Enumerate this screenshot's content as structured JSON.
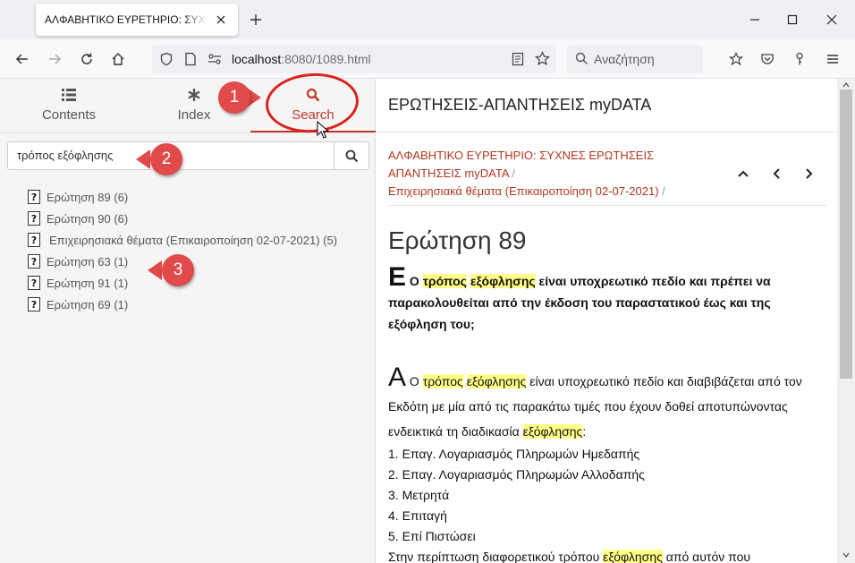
{
  "browser": {
    "tab_title": "ΑΛΦΑΒΗΤΙΚΟ ΕΥΡΕΤΗΡΙΟ: ΣΥΧΝΕΣ ΕΡΩΤΗΣΕΙΣ",
    "url_host": "localhost",
    "url_rest": ":8080/1089.html",
    "search_placeholder": "Αναζήτηση"
  },
  "sidebar": {
    "tabs": [
      {
        "label": "Contents",
        "icon": "list-icon"
      },
      {
        "label": "Index",
        "icon": "asterisk-icon"
      },
      {
        "label": "Search",
        "icon": "search-icon"
      }
    ],
    "active_tab": "Search",
    "search_value": "τρόπος εξόφλησης",
    "results": [
      {
        "label": "Ερώτηση 89 (6)"
      },
      {
        "label": "Ερώτηση 90 (6)"
      },
      {
        "label": "Επιχειρησιακά θέματα (Επικαιροποίηση 02-07-2021) (5)"
      },
      {
        "label": "Ερώτηση 63 (1)"
      },
      {
        "label": "Ερώτηση 91 (1)"
      },
      {
        "label": "Ερώτηση 69 (1)"
      }
    ]
  },
  "callouts": {
    "one": "1",
    "two": "2",
    "three": "3"
  },
  "content": {
    "header": "ΕΡΩΤΗΣΕΙΣ-ΑΠΑΝΤΗΣΕΙΣ myDATA",
    "crumb1_line1": "ΑΛΦΑΒΗΤΙΚΟ ΕΥΡΕΤΗΡΙΟ: ΣΥΧΝΕΣ ΕΡΩΤΗΣΕΙΣ",
    "crumb1_line2": "ΑΠΑΝΤΗΣΕΙΣ myDATA",
    "crumb2": "Επιχειρησιακά θέματα (Επικαιροποίηση 02-07-2021)",
    "crumb_sep": "/",
    "title": "Ερώτηση 89",
    "question": {
      "dropcap": "Ε",
      "p1": " Ο ",
      "hl1": "τρόπος",
      "sp1": " ",
      "hl2": "εξόφλησης",
      "rest": "  είναι υποχρεωτικό πεδίο και πρέπει να παρακολουθείται από την έκδοση του παραστατικού έως και της εξόφληση του;"
    },
    "answer": {
      "dropcap": "Α",
      "p1": " Ο ",
      "hl1": "τρόπος",
      "sp1": " ",
      "hl2": "εξόφλησης",
      "rest1": " είναι υποχρεωτικό πεδίο και διαβιβάζεται από τον Εκδότη με μία από τις παρακάτω τιμές που έχουν δοθεί αποτυπώνοντας ενδεικτικά τη διαδικασία ",
      "hl3": "εξόφλησης",
      "rest2": ":",
      "items": [
        "1. Επαγ. Λογαριασμός Πληρωμών Ημεδαπής",
        "2. Επαγ. Λογαριασμός Πληρωμών Αλλοδαπής",
        "3. Μετρητά",
        "4. Επιταγή",
        "5. Επί Πιστώσει"
      ],
      "last_p1": "Στην περίπτωση διαφορετικού τρόπου ",
      "last_hl": "εξόφλησης",
      "last_p2": " από αυτόν που"
    }
  },
  "colors": {
    "accent": "#c0392b",
    "callout": "#e04a4a",
    "highlight": "#ffff88"
  }
}
